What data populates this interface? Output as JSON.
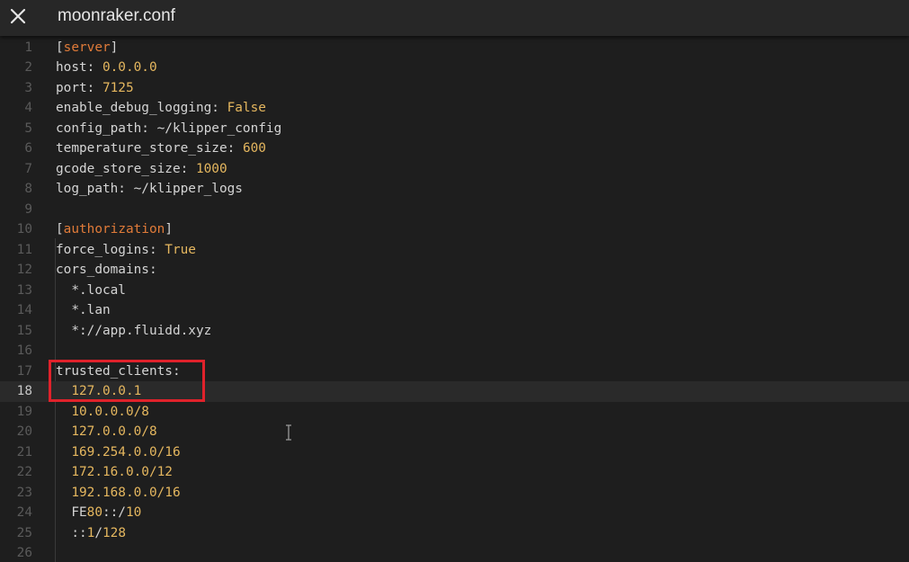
{
  "titlebar": {
    "title": "moonraker.conf",
    "close_icon": "close-icon"
  },
  "editor": {
    "current_line": 18,
    "lines": [
      {
        "n": "1",
        "parts": [
          {
            "t": "[",
            "c": "br"
          },
          {
            "t": "server",
            "c": "sec"
          },
          {
            "t": "]",
            "c": "br"
          }
        ]
      },
      {
        "n": "2",
        "parts": [
          {
            "t": "host: ",
            "c": "key"
          },
          {
            "t": "0.0.0.0",
            "c": "val"
          }
        ]
      },
      {
        "n": "3",
        "parts": [
          {
            "t": "port: ",
            "c": "key"
          },
          {
            "t": "7125",
            "c": "val"
          }
        ]
      },
      {
        "n": "4",
        "parts": [
          {
            "t": "enable_debug_logging: ",
            "c": "key"
          },
          {
            "t": "False",
            "c": "val"
          }
        ]
      },
      {
        "n": "5",
        "parts": [
          {
            "t": "config_path: ~/klipper_config",
            "c": "key"
          }
        ]
      },
      {
        "n": "6",
        "parts": [
          {
            "t": "temperature_store_size: ",
            "c": "key"
          },
          {
            "t": "600",
            "c": "val"
          }
        ]
      },
      {
        "n": "7",
        "parts": [
          {
            "t": "gcode_store_size: ",
            "c": "key"
          },
          {
            "t": "1000",
            "c": "val"
          }
        ]
      },
      {
        "n": "8",
        "parts": [
          {
            "t": "log_path: ~/klipper_logs",
            "c": "key"
          }
        ]
      },
      {
        "n": "9",
        "parts": []
      },
      {
        "n": "10",
        "parts": [
          {
            "t": "[",
            "c": "br"
          },
          {
            "t": "authorization",
            "c": "sec"
          },
          {
            "t": "]",
            "c": "br"
          }
        ]
      },
      {
        "n": "11",
        "parts": [
          {
            "t": "force_logins: ",
            "c": "key"
          },
          {
            "t": "True",
            "c": "val"
          }
        ]
      },
      {
        "n": "12",
        "parts": [
          {
            "t": "cors_domains:",
            "c": "key"
          }
        ]
      },
      {
        "n": "13",
        "parts": [
          {
            "t": "  *.local",
            "c": "key"
          }
        ]
      },
      {
        "n": "14",
        "parts": [
          {
            "t": "  *.lan",
            "c": "key"
          }
        ]
      },
      {
        "n": "15",
        "parts": [
          {
            "t": "  *://app.fluidd.xyz",
            "c": "key"
          }
        ]
      },
      {
        "n": "16",
        "parts": []
      },
      {
        "n": "17",
        "parts": [
          {
            "t": "trusted_clients:",
            "c": "key"
          }
        ]
      },
      {
        "n": "18",
        "parts": [
          {
            "t": "  ",
            "c": "key"
          },
          {
            "t": "127.0.0.1",
            "c": "val"
          }
        ]
      },
      {
        "n": "19",
        "parts": [
          {
            "t": "  ",
            "c": "key"
          },
          {
            "t": "10.0.0.0/8",
            "c": "val"
          }
        ]
      },
      {
        "n": "20",
        "parts": [
          {
            "t": "  ",
            "c": "key"
          },
          {
            "t": "127.0.0.0/8",
            "c": "val"
          }
        ]
      },
      {
        "n": "21",
        "parts": [
          {
            "t": "  ",
            "c": "key"
          },
          {
            "t": "169.254.0.0/16",
            "c": "val"
          }
        ]
      },
      {
        "n": "22",
        "parts": [
          {
            "t": "  ",
            "c": "key"
          },
          {
            "t": "172.16.0.0/12",
            "c": "val"
          }
        ]
      },
      {
        "n": "23",
        "parts": [
          {
            "t": "  ",
            "c": "key"
          },
          {
            "t": "192.168.0.0/16",
            "c": "val"
          }
        ]
      },
      {
        "n": "24",
        "parts": [
          {
            "t": "  FE",
            "c": "key"
          },
          {
            "t": "80",
            "c": "val"
          },
          {
            "t": "::/",
            "c": "key"
          },
          {
            "t": "10",
            "c": "val"
          }
        ]
      },
      {
        "n": "25",
        "parts": [
          {
            "t": "  ::",
            "c": "key"
          },
          {
            "t": "1",
            "c": "val"
          },
          {
            "t": "/",
            "c": "key"
          },
          {
            "t": "128",
            "c": "val"
          }
        ]
      },
      {
        "n": "26",
        "parts": []
      }
    ]
  },
  "colors": {
    "background": "#1e1e1e",
    "titlebar": "#272727",
    "section": "#e07b39",
    "value": "#e5b75f",
    "text": "#d4d4d4",
    "line_number": "#5a5a5a",
    "highlight_border": "#e0222b"
  }
}
